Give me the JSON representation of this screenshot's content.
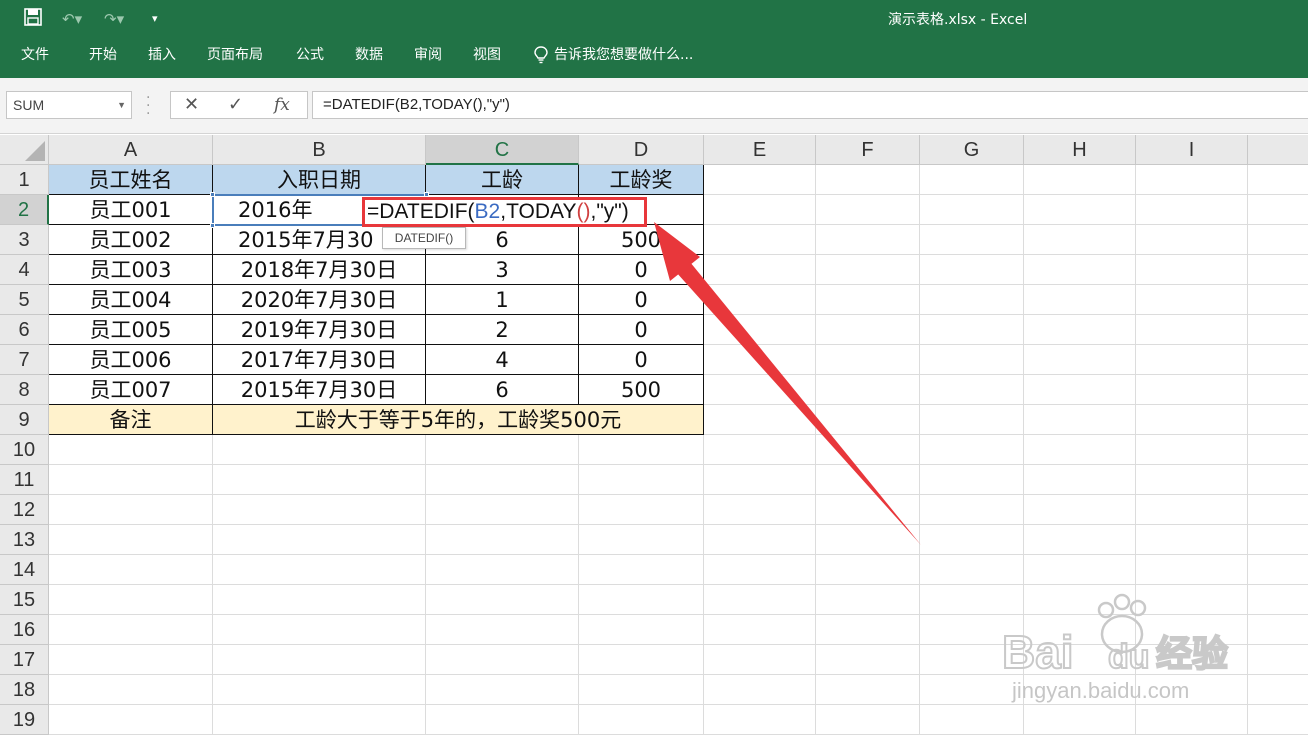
{
  "window": {
    "title": "演示表格.xlsx - Excel"
  },
  "quick_access": {
    "save_icon": "save-icon",
    "undo_icon": "undo-icon",
    "redo_icon": "redo-icon",
    "customize_icon": "customize-icon"
  },
  "ribbon": {
    "tabs": [
      {
        "label": "文件"
      },
      {
        "label": "开始"
      },
      {
        "label": "插入"
      },
      {
        "label": "页面布局"
      },
      {
        "label": "公式"
      },
      {
        "label": "数据"
      },
      {
        "label": "审阅"
      },
      {
        "label": "视图"
      }
    ],
    "tell_me": "告诉我您想要做什么..."
  },
  "formula_bar": {
    "name_box": "SUM",
    "cancel_glyph": "✕",
    "enter_glyph": "✓",
    "fx_glyph": "fx",
    "formula": "=DATEDIF(B2,TODAY(),\"y\")"
  },
  "columns": [
    "A",
    "B",
    "C",
    "D",
    "E",
    "F",
    "G",
    "H",
    "I"
  ],
  "rows": [
    "1",
    "2",
    "3",
    "4",
    "5",
    "6",
    "7",
    "8",
    "9",
    "10",
    "11",
    "12",
    "13",
    "14",
    "15",
    "16",
    "17",
    "18",
    "19"
  ],
  "active": {
    "column": "C",
    "row": "2"
  },
  "table": {
    "headers": [
      "员工姓名",
      "入职日期",
      "工龄",
      "工龄奖"
    ],
    "rows": [
      [
        "员工001",
        "2016年",
        "",
        ""
      ],
      [
        "员工002",
        "2015年7月30",
        "6",
        "500"
      ],
      [
        "员工003",
        "2018年7月30日",
        "3",
        "0"
      ],
      [
        "员工004",
        "2020年7月30日",
        "1",
        "0"
      ],
      [
        "员工005",
        "2019年7月30日",
        "2",
        "0"
      ],
      [
        "员工006",
        "2017年7月30日",
        "4",
        "0"
      ],
      [
        "员工007",
        "2015年7月30日",
        "6",
        "500"
      ]
    ],
    "note_label": "备注",
    "note_text": "工龄大于等于5年的，工龄奖500元"
  },
  "in_cell_edit": {
    "prefix": "=DATEDIF(",
    "ref": "B2",
    "mid": ",TODAY",
    "parens": "()",
    "suffix": ",\"y\")"
  },
  "tooltip": "DATEDIF()",
  "colors": {
    "ribbon": "#217346",
    "header_fill": "#bdd7ee",
    "note_fill": "#fff2cc",
    "annotation": "#e8373b"
  },
  "watermark": {
    "brand": "Bai du 经验",
    "url": "jingyan.baidu.com"
  }
}
